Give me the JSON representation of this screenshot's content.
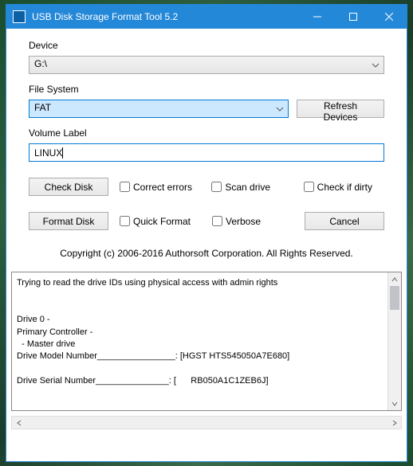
{
  "window": {
    "title": "USB Disk Storage Format Tool 5.2"
  },
  "labels": {
    "device": "Device",
    "file_system": "File System",
    "volume_label": "Volume Label"
  },
  "device": {
    "value": "G:\\"
  },
  "file_system": {
    "value": "FAT"
  },
  "volume_label": {
    "value": "LINUX"
  },
  "buttons": {
    "refresh": "Refresh Devices",
    "check_disk": "Check Disk",
    "format_disk": "Format Disk",
    "cancel": "Cancel"
  },
  "checkboxes": {
    "correct_errors": "Correct errors",
    "scan_drive": "Scan drive",
    "check_if_dirty": "Check if dirty",
    "quick_format": "Quick Format",
    "verbose": "Verbose"
  },
  "copyright": "Copyright (c) 2006-2016 Authorsoft Corporation. All Rights Reserved.",
  "log": "Trying to read the drive IDs using physical access with admin rights\n\n\nDrive 0 - \nPrimary Controller - \n  - Master drive\nDrive Model Number________________: [HGST HTS545050A7E680]\n\nDrive Serial Number_______________: [      RB050A1C1ZEB6J]\n"
}
